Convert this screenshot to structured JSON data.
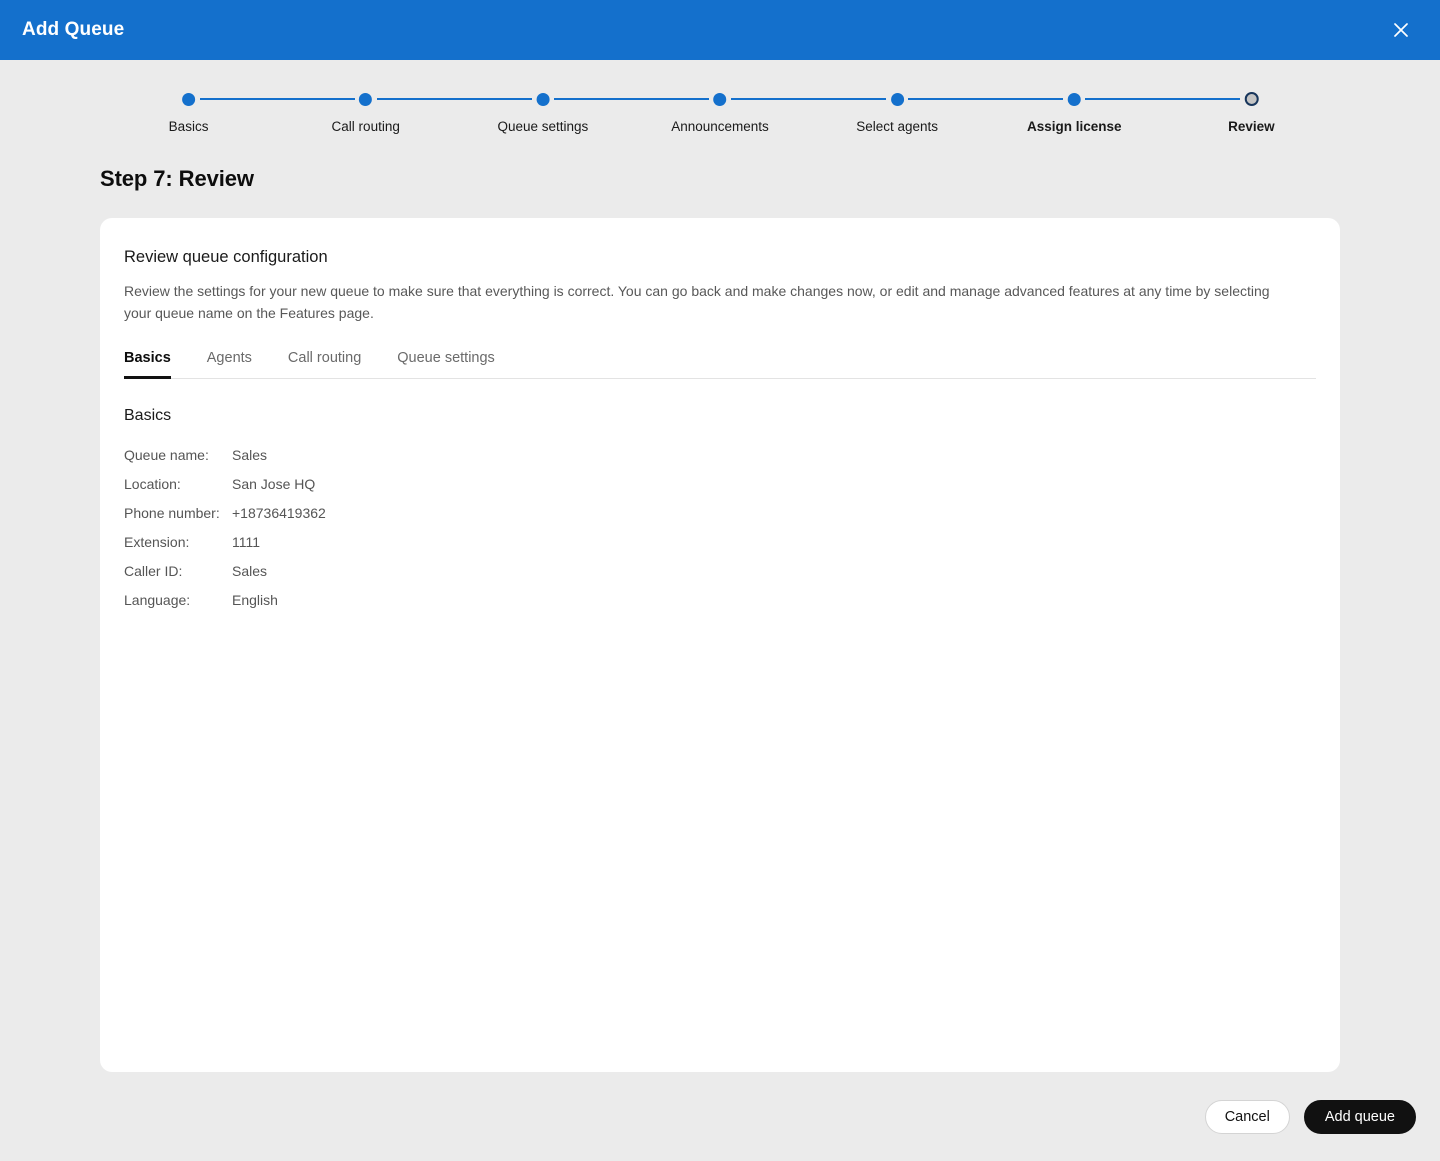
{
  "window": {
    "title": "Add Queue",
    "close_icon": "close-icon"
  },
  "colors": {
    "header_blue": "#1470cc",
    "step_active_blue": "#1470cc",
    "step_current_ring": "#18365c",
    "step_current_fill": "#c4c4c4",
    "page_background": "#ebebeb",
    "card_background": "#ffffff",
    "primary_button": "#111111",
    "tab_active_underline": "#111111"
  },
  "stepper": {
    "steps": [
      {
        "label": "Basics",
        "state": "complete"
      },
      {
        "label": "Call routing",
        "state": "complete"
      },
      {
        "label": "Queue settings",
        "state": "complete"
      },
      {
        "label": "Announcements",
        "state": "complete"
      },
      {
        "label": "Select agents",
        "state": "complete"
      },
      {
        "label": "Assign license",
        "state": "complete"
      },
      {
        "label": "Review",
        "state": "current"
      }
    ]
  },
  "page": {
    "step_heading": "Step 7: Review"
  },
  "card": {
    "title": "Review queue configuration",
    "description": "Review the settings for your new queue to make sure that everything is correct. You can go back and make changes now, or edit and manage advanced features at any time by selecting your queue name on the Features page.",
    "tabs": [
      {
        "label": "Basics",
        "active": true
      },
      {
        "label": "Agents",
        "active": false
      },
      {
        "label": "Call routing",
        "active": false
      },
      {
        "label": "Queue settings",
        "active": false
      }
    ],
    "section_title": "Basics",
    "details": [
      {
        "label": "Queue name:",
        "value": "Sales"
      },
      {
        "label": "Location:",
        "value": "San Jose HQ"
      },
      {
        "label": "Phone number:",
        "value": "+18736419362"
      },
      {
        "label": "Extension:",
        "value": "1111"
      },
      {
        "label": "Caller ID:",
        "value": "Sales"
      },
      {
        "label": "Language:",
        "value": "English"
      }
    ]
  },
  "footer": {
    "cancel_label": "Cancel",
    "submit_label": "Add queue"
  }
}
